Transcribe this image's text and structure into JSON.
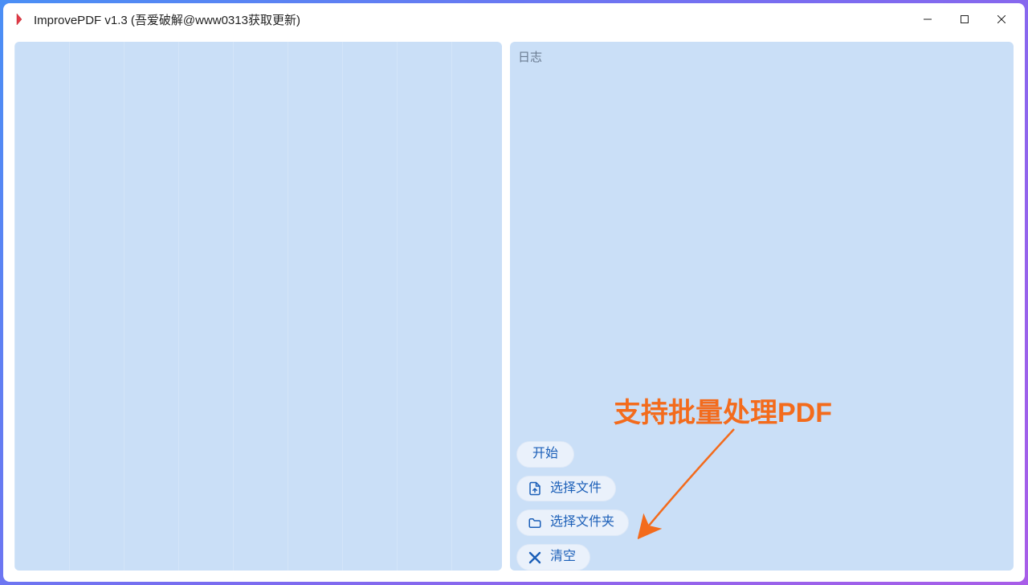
{
  "window": {
    "title": "ImprovePDF v1.3 (吾爱破解@www0313获取更新)"
  },
  "right": {
    "log_label": "日志"
  },
  "buttons": {
    "start": "开始",
    "select_file": "选择文件",
    "select_folder": "选择文件夹",
    "clear": "清空"
  },
  "annotation": {
    "text": "支持批量处理PDF"
  },
  "colors": {
    "accent_orange": "#f36b1c",
    "button_text": "#1b5fb8",
    "panel_bg": "#cadff7"
  }
}
